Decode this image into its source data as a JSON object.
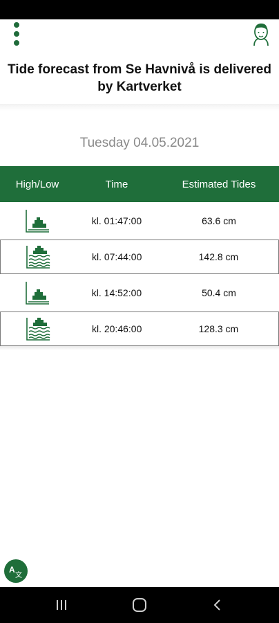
{
  "header": {
    "title_line1": "Tide forecast from Se Havnivå is delivered",
    "title_line2": "by Kartverket"
  },
  "date": "Tuesday 04.05.2021",
  "table": {
    "columns": [
      "High/Low",
      "Time",
      "Estimated Tides"
    ],
    "rows": [
      {
        "type": "low-tide-icon",
        "time": "kl. 01:47:00",
        "tide": "63.6 cm"
      },
      {
        "type": "high-tide-icon",
        "time": "kl. 07:44:00",
        "tide": "142.8 cm"
      },
      {
        "type": "low-tide-icon",
        "time": "kl. 14:52:00",
        "tide": "50.4 cm"
      },
      {
        "type": "high-tide-icon",
        "time": "kl. 20:46:00",
        "tide": "128.3 cm"
      }
    ]
  },
  "colors": {
    "accent": "#1f6e3a",
    "date_text": "#8a8a8a"
  },
  "icons": {
    "menu": "more-vertical-icon",
    "avatar": "user-avatar-icon",
    "translate": "translate-icon",
    "nav_recent": "recent-apps-icon",
    "nav_home": "home-icon",
    "nav_back": "back-icon"
  }
}
